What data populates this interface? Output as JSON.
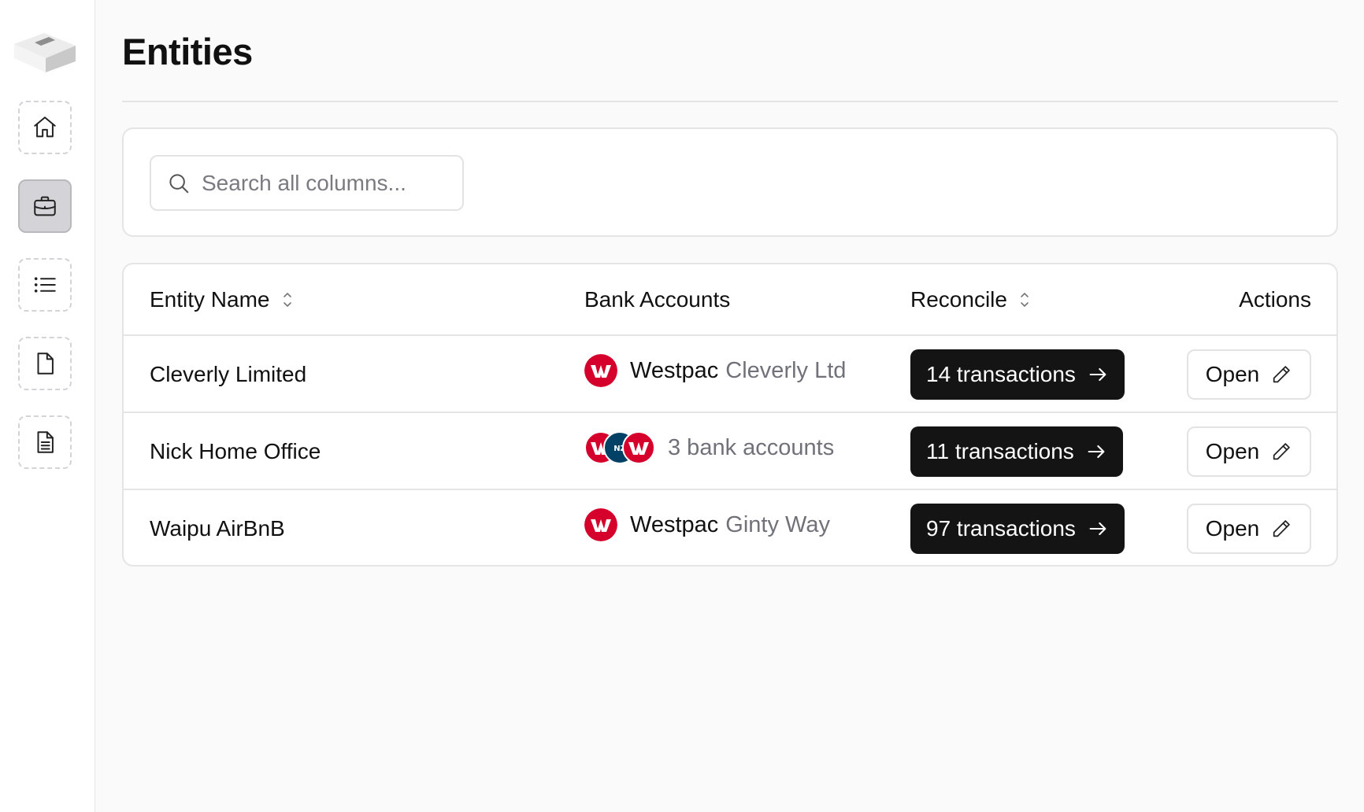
{
  "page": {
    "title": "Entities"
  },
  "sidebar": {
    "items": [
      {
        "name": "home",
        "icon": "home-icon"
      },
      {
        "name": "entities",
        "icon": "briefcase-icon",
        "active": true
      },
      {
        "name": "list",
        "icon": "list-icon"
      },
      {
        "name": "file",
        "icon": "file-icon"
      },
      {
        "name": "document",
        "icon": "document-text-icon"
      }
    ]
  },
  "search": {
    "placeholder": "Search all columns..."
  },
  "table": {
    "headers": {
      "entity_name": "Entity Name",
      "bank_accounts": "Bank Accounts",
      "reconcile": "Reconcile",
      "actions": "Actions"
    },
    "rows": [
      {
        "entity": "Cleverly Limited",
        "bank_name": "Westpac",
        "bank_account": "Cleverly Ltd",
        "reconcile_label": "14 transactions",
        "action_label": "Open"
      },
      {
        "entity": "Nick Home Office",
        "bank_summary": "3 bank accounts",
        "reconcile_label": "11 transactions",
        "action_label": "Open"
      },
      {
        "entity": "Waipu AirBnB",
        "bank_name": "Westpac",
        "bank_account": "Ginty Way",
        "reconcile_label": "97 transactions",
        "action_label": "Open"
      }
    ]
  },
  "colors": {
    "westpac_red": "#d5002b",
    "anz_blue": "#004165",
    "primary_button": "#141414",
    "border": "#e5e5e5"
  }
}
